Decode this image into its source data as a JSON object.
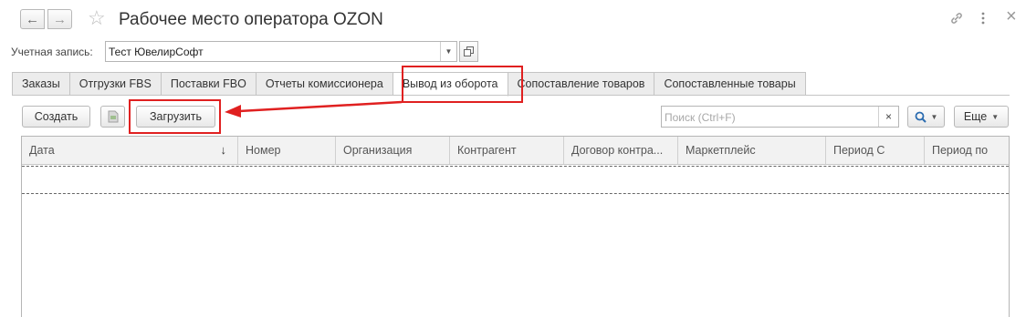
{
  "window": {
    "title": "Рабочее место оператора OZON",
    "back_glyph": "←",
    "forward_glyph": "→",
    "favorite_glyph": "☆",
    "link_glyph": "🔗",
    "menu_glyph": "⋮",
    "close_glyph": "×"
  },
  "account": {
    "label": "Учетная запись:",
    "value": "Тест ЮвелирСофт",
    "dropdown_glyph": "▼",
    "open_glyph": "⧉"
  },
  "tabs": [
    {
      "label": "Заказы"
    },
    {
      "label": "Отгрузки FBS"
    },
    {
      "label": "Поставки FBO"
    },
    {
      "label": "Отчеты комиссионера"
    },
    {
      "label": "Вывод из оборота",
      "active": true
    },
    {
      "label": "Сопоставление товаров"
    },
    {
      "label": "Сопоставленные товары"
    }
  ],
  "toolbar": {
    "create_label": "Создать",
    "load_label": "Загрузить",
    "search_placeholder": "Поиск (Ctrl+F)",
    "clear_glyph": "×",
    "find_glyph": "🔍",
    "more_label": "Еще",
    "caret_glyph": "▼"
  },
  "table": {
    "columns": [
      {
        "label": "Дата",
        "sort": "↓"
      },
      {
        "label": "Номер"
      },
      {
        "label": "Организация"
      },
      {
        "label": "Контрагент"
      },
      {
        "label": "Договор контра..."
      },
      {
        "label": "Маркетплейс"
      },
      {
        "label": "Период С"
      },
      {
        "label": "Период по"
      }
    ],
    "rows": []
  },
  "colors": {
    "highlight": "#e02020",
    "accent": "#2b6cb0"
  }
}
